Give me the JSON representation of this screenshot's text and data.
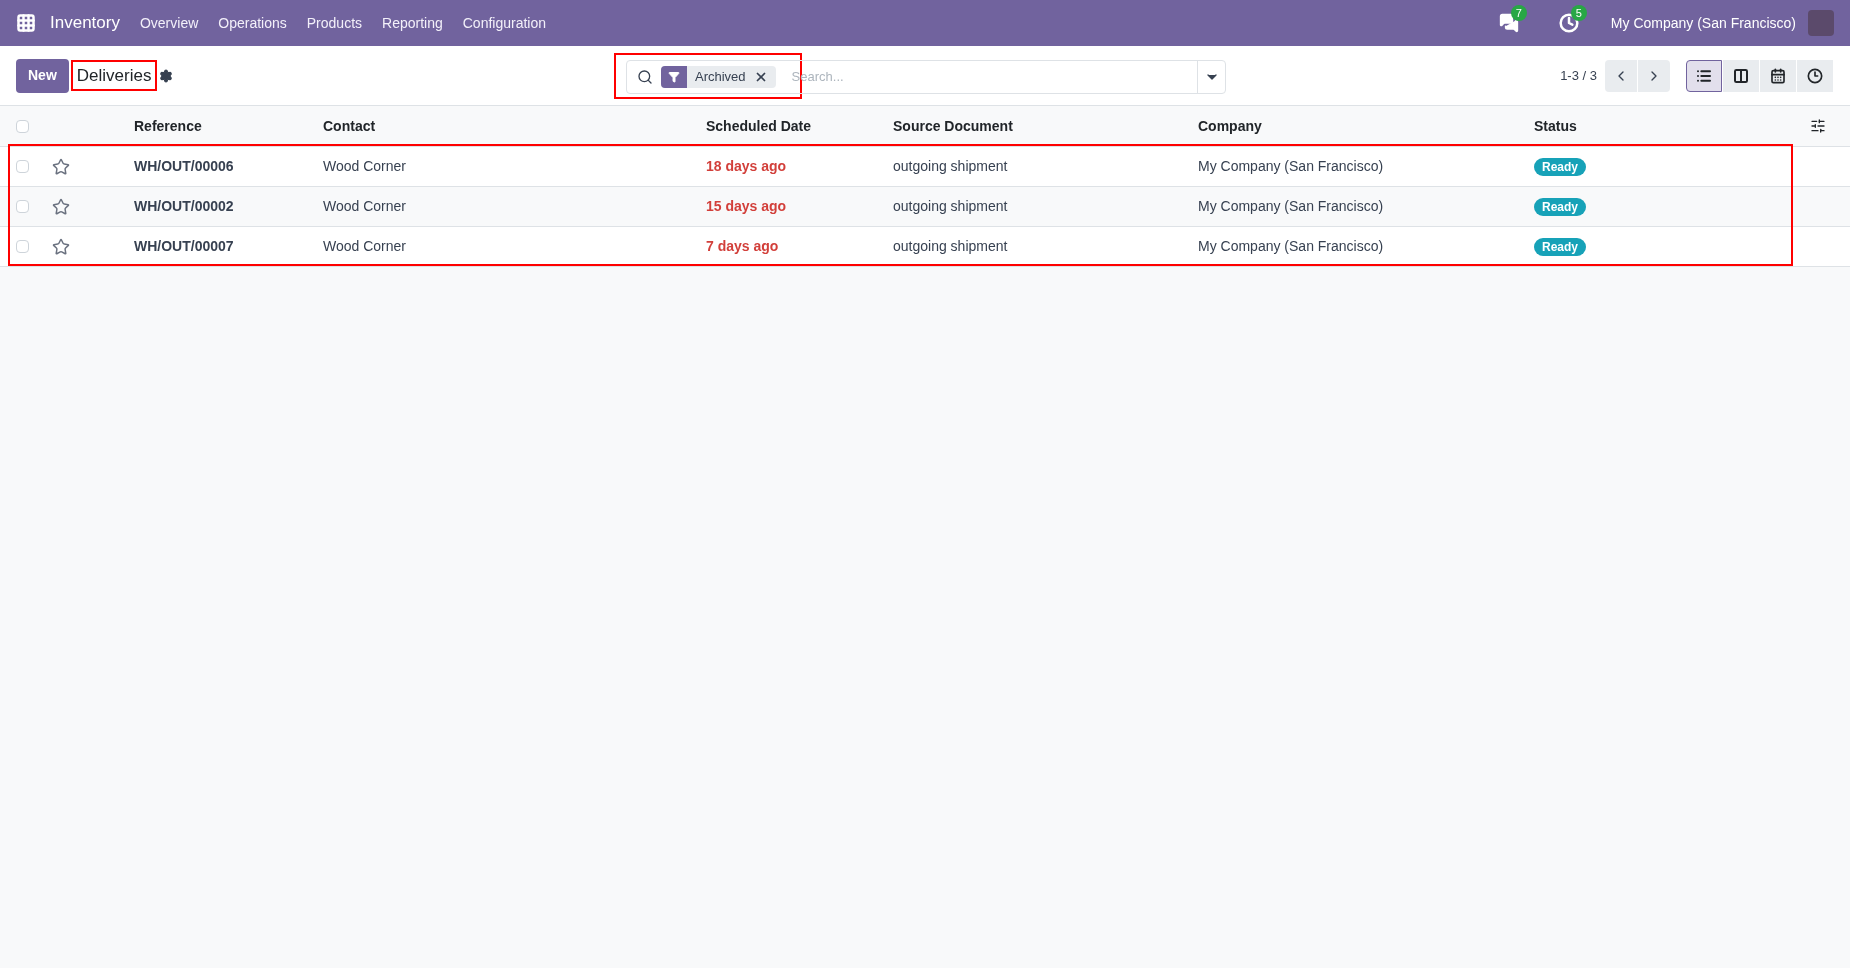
{
  "navbar": {
    "app": "Inventory",
    "menu": [
      "Overview",
      "Operations",
      "Products",
      "Reporting",
      "Configuration"
    ],
    "messages_count": "7",
    "activities_count": "5",
    "company": "My Company (San Francisco)"
  },
  "control_panel": {
    "new_button": "New",
    "title": "Deliveries",
    "title_highlighted": true,
    "search_highlighted": true,
    "facets": [
      {
        "label": "Archived"
      }
    ],
    "search_placeholder": "Search...",
    "pager": "1-3 / 3",
    "views": [
      {
        "kind": "list",
        "selected": true
      },
      {
        "kind": "kanban",
        "selected": false
      },
      {
        "kind": "calendar",
        "selected": false
      },
      {
        "kind": "activity",
        "selected": false
      }
    ]
  },
  "table": {
    "columns": [
      "Reference",
      "Contact",
      "Scheduled Date",
      "Source Document",
      "Company",
      "Status"
    ],
    "rows_highlighted": true,
    "select_all_checked": false,
    "rows": [
      {
        "checked": false,
        "starred": false,
        "reference": "WH/OUT/00006",
        "contact": "Wood Corner",
        "scheduled_date": "18 days ago",
        "overdue": true,
        "source_document": "outgoing shipment",
        "company": "My Company (San Francisco)",
        "status": "Ready"
      },
      {
        "checked": false,
        "starred": false,
        "reference": "WH/OUT/00002",
        "contact": "Wood Corner",
        "scheduled_date": "15 days ago",
        "overdue": true,
        "source_document": "outgoing shipment",
        "company": "My Company (San Francisco)",
        "status": "Ready"
      },
      {
        "checked": false,
        "starred": false,
        "reference": "WH/OUT/00007",
        "contact": "Wood Corner",
        "scheduled_date": "7 days ago",
        "overdue": true,
        "source_document": "outgoing shipment",
        "company": "My Company (San Francisco)",
        "status": "Ready"
      }
    ]
  }
}
